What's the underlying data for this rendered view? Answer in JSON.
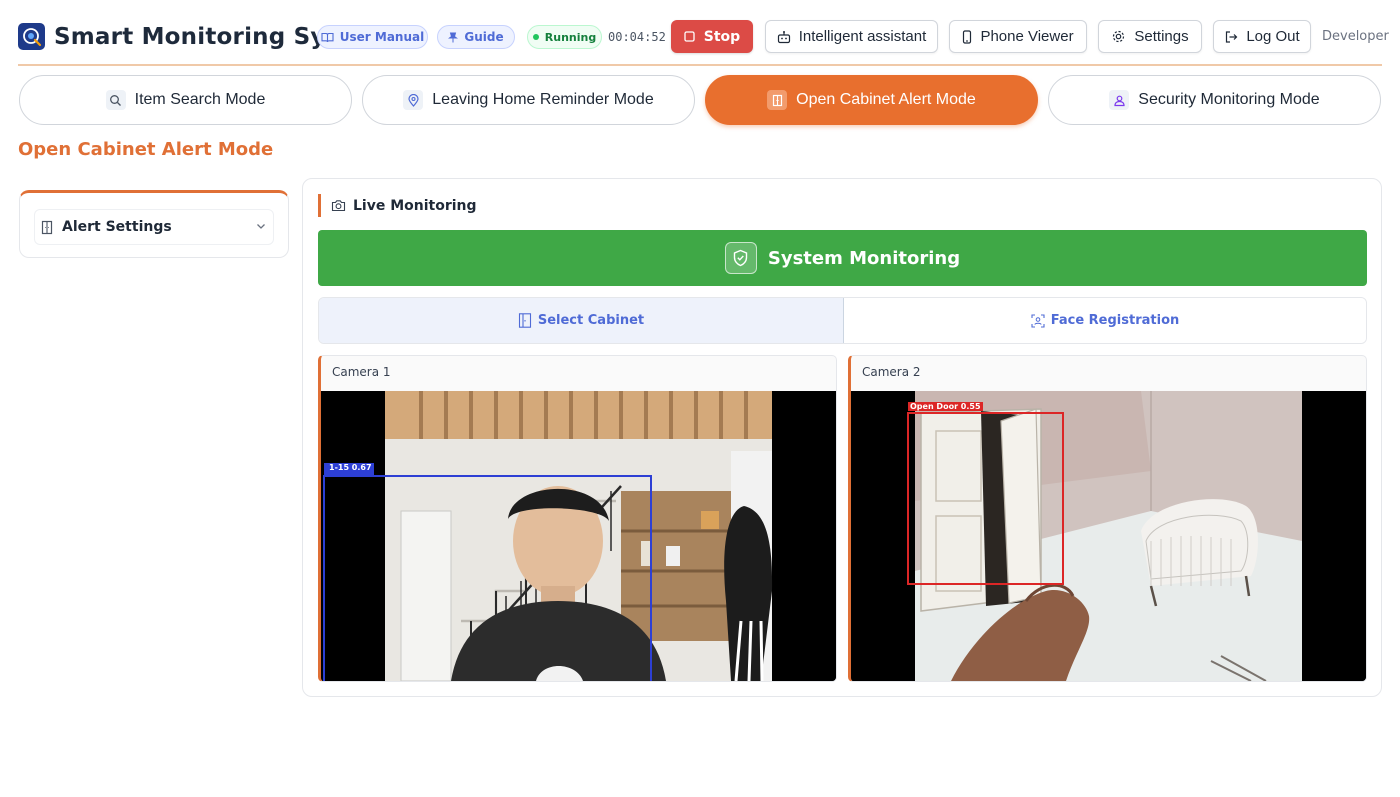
{
  "header": {
    "app_title": "Smart Monitoring System",
    "user_manual_label": "User Manual",
    "guide_label": "Guide",
    "status_label": "Running",
    "timer": "00:04:52",
    "stop_label": "Stop",
    "assistant_label": "Intelligent assistant",
    "phone_viewer_label": "Phone Viewer",
    "settings_label": "Settings",
    "logout_label": "Log Out",
    "developer_label": "Developer"
  },
  "modes": {
    "item_search": "Item Search Mode",
    "leaving_home": "Leaving Home Reminder Mode",
    "open_cabinet": "Open Cabinet Alert Mode",
    "security": "Security Monitoring Mode",
    "active": "open_cabinet"
  },
  "page": {
    "title": "Open Cabinet Alert Mode"
  },
  "sidebar": {
    "alert_settings_label": "Alert Settings"
  },
  "main": {
    "live_label": "Live Monitoring",
    "system_label": "System Monitoring",
    "subtabs": {
      "select_cabinet": "Select Cabinet",
      "face_registration": "Face Registration"
    },
    "cameras": [
      {
        "label": "Camera 1",
        "detection": "1-15 0.67"
      },
      {
        "label": "Camera 2",
        "detection": "Open Door 0.55"
      }
    ]
  },
  "colors": {
    "accent": "#e07036",
    "active_tab": "#e86f2e",
    "stop": "#dc4b46",
    "system_bar": "#3fa846",
    "link_blue": "#4f6bd6",
    "detection_blue": "#2d3fd4",
    "detection_red": "#dc2626"
  },
  "icons": {
    "logo": "camera-logo-icon",
    "manual": "book-icon",
    "guide": "pin-icon",
    "stop": "stop-icon",
    "assistant": "robot-icon",
    "phone": "phone-icon",
    "settings": "gear-icon",
    "logout": "logout-icon",
    "item_search": "search-icon",
    "leaving_home": "location-pin-icon",
    "open_cabinet": "cabinet-icon",
    "security": "user-shield-icon",
    "live": "camera-icon",
    "system": "shield-check-icon",
    "select_cabinet": "door-icon",
    "face_registration": "face-scan-icon"
  }
}
